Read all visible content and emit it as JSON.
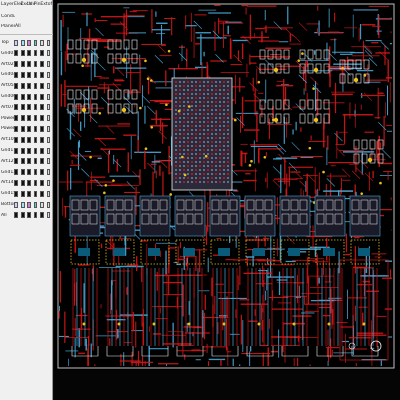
{
  "layer_panel": {
    "header": {
      "layer": "Layer",
      "cols": [
        "Elec",
        "Exch",
        "Ldv",
        "Pin",
        "Ext",
        "of"
      ]
    },
    "conductors_label": "Conductors",
    "planes_label": "Planes",
    "planes_value": "All",
    "layers": [
      {
        "name": "Top",
        "swatches": [
          "#c8d0ff",
          "#9ae0ff",
          "#d27bd2",
          "#3ad2d2",
          "#dcdcdc",
          "#dcdcdc"
        ]
      },
      {
        "name": "Gnd01",
        "swatches": [
          "#111",
          "#111",
          "#111",
          "#111",
          "#111",
          "#dcdcdc"
        ]
      },
      {
        "name": "Art02",
        "swatches": [
          "#111",
          "#111",
          "#111",
          "#111",
          "#111",
          "#dcdcdc"
        ]
      },
      {
        "name": "Gnd04",
        "swatches": [
          "#111",
          "#111",
          "#111",
          "#111",
          "#111",
          "#dcdcdc"
        ]
      },
      {
        "name": "Art05",
        "swatches": [
          "#111",
          "#111",
          "#111",
          "#111",
          "#111",
          "#dcdcdc"
        ]
      },
      {
        "name": "Gnd06",
        "swatches": [
          "#111",
          "#111",
          "#111",
          "#111",
          "#111",
          "#dcdcdc"
        ]
      },
      {
        "name": "Art07",
        "swatches": [
          "#111",
          "#111",
          "#111",
          "#111",
          "#111",
          "#dcdcdc"
        ]
      },
      {
        "name": "Power08",
        "swatches": [
          "#111",
          "#111",
          "#111",
          "#111",
          "#111",
          "#dcdcdc"
        ]
      },
      {
        "name": "Power09",
        "swatches": [
          "#111",
          "#111",
          "#111",
          "#111",
          "#111",
          "#dcdcdc"
        ]
      },
      {
        "name": "Art10",
        "swatches": [
          "#111",
          "#111",
          "#111",
          "#111",
          "#111",
          "#dcdcdc"
        ]
      },
      {
        "name": "Gnd11",
        "swatches": [
          "#111",
          "#111",
          "#111",
          "#111",
          "#111",
          "#dcdcdc"
        ]
      },
      {
        "name": "Art12",
        "swatches": [
          "#111",
          "#111",
          "#111",
          "#111",
          "#111",
          "#dcdcdc"
        ]
      },
      {
        "name": "Gnd13",
        "swatches": [
          "#111",
          "#111",
          "#111",
          "#111",
          "#111",
          "#dcdcdc"
        ]
      },
      {
        "name": "Art14",
        "swatches": [
          "#111",
          "#111",
          "#111",
          "#111",
          "#111",
          "#dcdcdc"
        ]
      },
      {
        "name": "Gnd15",
        "swatches": [
          "#111",
          "#111",
          "#111",
          "#111",
          "#111",
          "#dcdcdc"
        ]
      },
      {
        "name": "Bottom",
        "swatches": [
          "#c8d0ff",
          "#9ae0ff",
          "#d27bd2",
          "#3ad2d2",
          "#dcdcdc",
          "#dcdcdc"
        ]
      },
      {
        "name": "All",
        "swatches": [
          "#111",
          "#111",
          "#111",
          "#111",
          "#111",
          "#dcdcdc"
        ]
      }
    ]
  },
  "colors": {
    "board_bg": "#000000",
    "trace_red": "#d01818",
    "trace_blue": "#4aa8d8",
    "via_yellow": "#e8c020",
    "pad_white": "#f0f0f0",
    "outline": "#c0c0c0"
  }
}
